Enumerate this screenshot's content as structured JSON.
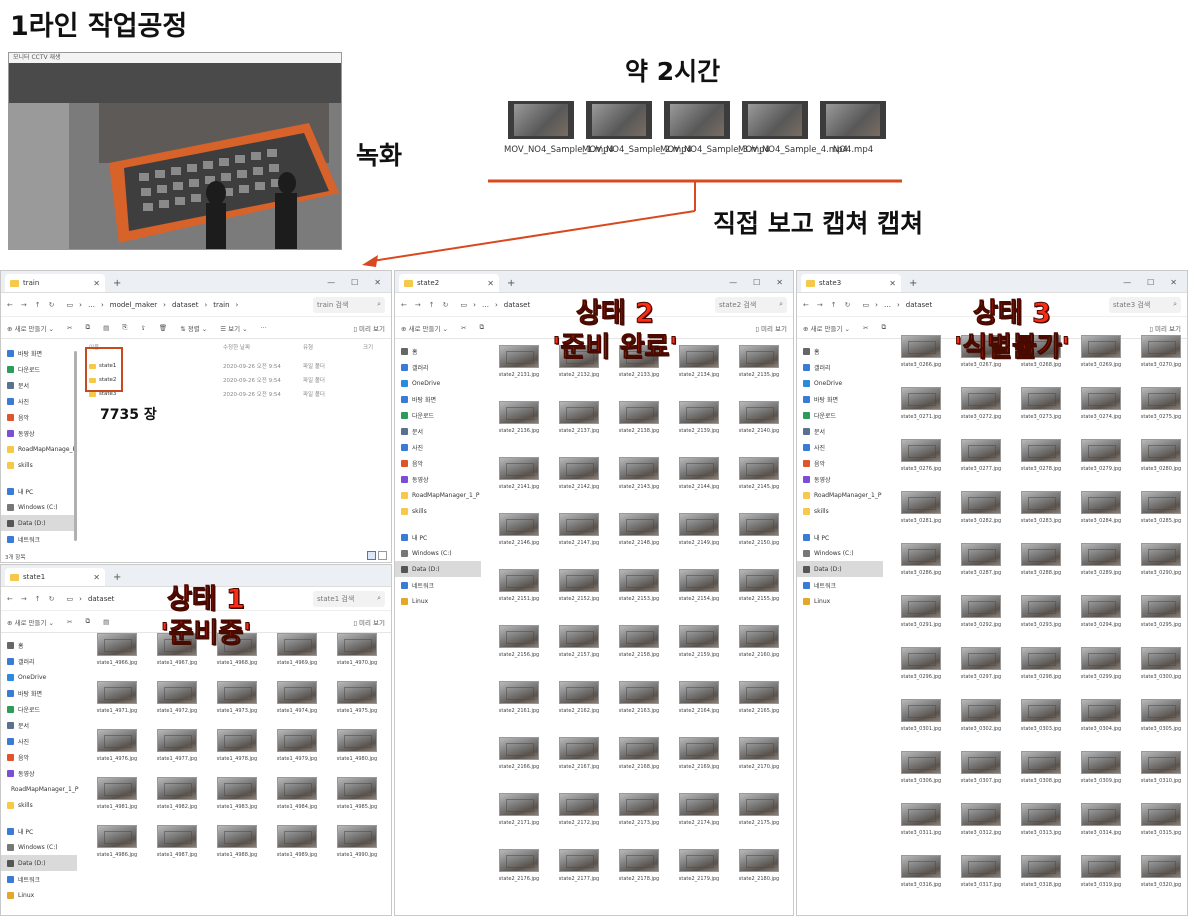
{
  "title": "1라인 작업공정",
  "video_window_title": "모니터 CCTV 재생",
  "record_label": "녹화",
  "duration_label": "약 2시간",
  "capture_label": "직접 보고 캡쳐 캡쳐",
  "accent_color": "#d9491f",
  "video_files": [
    {
      "name": "MOV_NO4_Sample_1.mp4"
    },
    {
      "name": "MOV_NO4_Sample_2.mp4"
    },
    {
      "name": "MOV_NO4_Sample_3.mp4"
    },
    {
      "name": "MOV_NO4_Sample_4.mp4"
    },
    {
      "name": "NO4.mp4"
    }
  ],
  "train_window": {
    "tab": "train",
    "breadcrumb": [
      "model_maker",
      "dataset",
      "train"
    ],
    "search": "train 검색",
    "new_label": "새로 만들기",
    "sort_label": "정렬",
    "view_label": "보기",
    "preview_label": "미리 보기",
    "columns": [
      "이름",
      "수정한 날짜",
      "유형",
      "크기"
    ],
    "rows": [
      {
        "name": "state1",
        "date": "2020-09-26 오전 9:54",
        "type": "파일 폴더"
      },
      {
        "name": "state2",
        "date": "2020-09-26 오전 9:54",
        "type": "파일 폴더"
      },
      {
        "name": "state3",
        "date": "2020-09-26 오전 9:54",
        "type": "파일 폴더"
      }
    ],
    "nav": [
      "바탕 화면",
      "다운로드",
      "문서",
      "사진",
      "음악",
      "동영상",
      "RoadMapManage_P",
      "skills",
      "내 PC",
      "Windows (C:)",
      "Data (D:)",
      "네트워크"
    ],
    "count": "7735 장",
    "status": "3개 항목"
  },
  "state1_window": {
    "tab": "state1",
    "crumb": "dataset",
    "search": "state1 검색",
    "new_label": "새로 만들기",
    "preview_label": "미리 보기",
    "overlay_line1": "상태 1",
    "overlay_line2": "'준비중'",
    "nav": [
      "홈",
      "갤러리",
      "OneDrive",
      "바탕 화면",
      "다운로드",
      "문서",
      "사진",
      "음악",
      "동영상",
      "RoadMapManager_1_P",
      "skills",
      "내 PC",
      "Windows (C:)",
      "Data (D:)",
      "네트워크",
      "Linux"
    ],
    "files": [
      "state1_4966.jpg",
      "state1_4967.jpg",
      "state1_4968.jpg",
      "state1_4969.jpg",
      "state1_4970.jpg",
      "state1_4971.jpg",
      "state1_4972.jpg",
      "state1_4973.jpg",
      "state1_4974.jpg",
      "state1_4975.jpg",
      "state1_4976.jpg",
      "state1_4977.jpg",
      "state1_4978.jpg",
      "state1_4979.jpg",
      "state1_4980.jpg",
      "state1_4981.jpg",
      "state1_4982.jpg",
      "state1_4983.jpg",
      "state1_4984.jpg",
      "state1_4985.jpg",
      "state1_4986.jpg",
      "state1_4987.jpg",
      "state1_4988.jpg",
      "state1_4989.jpg",
      "state1_4990.jpg"
    ]
  },
  "state2_window": {
    "tab": "state2",
    "crumb": "dataset",
    "search": "state2 검색",
    "new_label": "새로 만들기",
    "preview_label": "미리 보기",
    "overlay_line1": "상태 2",
    "overlay_line2": "'준비 완료'",
    "nav": [
      "홈",
      "갤러리",
      "OneDrive",
      "바탕 화면",
      "다운로드",
      "문서",
      "사진",
      "음악",
      "동영상",
      "RoadMapManager_1_P",
      "skills",
      "내 PC",
      "Windows (C:)",
      "Data (D:)",
      "네트워크",
      "Linux"
    ],
    "files": [
      "state2_2131.jpg",
      "state2_2132.jpg",
      "state2_2133.jpg",
      "state2_2134.jpg",
      "state2_2135.jpg",
      "state2_2136.jpg",
      "state2_2137.jpg",
      "state2_2138.jpg",
      "state2_2139.jpg",
      "state2_2140.jpg",
      "state2_2141.jpg",
      "state2_2142.jpg",
      "state2_2143.jpg",
      "state2_2144.jpg",
      "state2_2145.jpg",
      "state2_2146.jpg",
      "state2_2147.jpg",
      "state2_2148.jpg",
      "state2_2149.jpg",
      "state2_2150.jpg",
      "state2_2151.jpg",
      "state2_2152.jpg",
      "state2_2153.jpg",
      "state2_2154.jpg",
      "state2_2155.jpg",
      "state2_2156.jpg",
      "state2_2157.jpg",
      "state2_2158.jpg",
      "state2_2159.jpg",
      "state2_2160.jpg",
      "state2_2161.jpg",
      "state2_2162.jpg",
      "state2_2163.jpg",
      "state2_2164.jpg",
      "state2_2165.jpg",
      "state2_2166.jpg",
      "state2_2167.jpg",
      "state2_2168.jpg",
      "state2_2169.jpg",
      "state2_2170.jpg",
      "state2_2171.jpg",
      "state2_2172.jpg",
      "state2_2173.jpg",
      "state2_2174.jpg",
      "state2_2175.jpg",
      "state2_2176.jpg",
      "state2_2177.jpg",
      "state2_2178.jpg",
      "state2_2179.jpg",
      "state2_2180.jpg"
    ]
  },
  "state3_window": {
    "tab": "state3",
    "crumb": "dataset",
    "search": "state3 검색",
    "new_label": "새로 만들기",
    "preview_label": "미리 보기",
    "overlay_line1": "상태 3",
    "overlay_line2": "'식별불가'",
    "nav": [
      "홈",
      "갤러리",
      "OneDrive",
      "바탕 화면",
      "다운로드",
      "문서",
      "사진",
      "음악",
      "동영상",
      "RoadMapManager_1_P",
      "skills",
      "내 PC",
      "Windows (C:)",
      "Data (D:)",
      "네트워크",
      "Linux"
    ],
    "files": [
      "state3_0266.jpg",
      "state3_0267.jpg",
      "state3_0268.jpg",
      "state3_0269.jpg",
      "state3_0270.jpg",
      "state3_0271.jpg",
      "state3_0272.jpg",
      "state3_0273.jpg",
      "state3_0274.jpg",
      "state3_0275.jpg",
      "state3_0276.jpg",
      "state3_0277.jpg",
      "state3_0278.jpg",
      "state3_0279.jpg",
      "state3_0280.jpg",
      "state3_0281.jpg",
      "state3_0282.jpg",
      "state3_0283.jpg",
      "state3_0284.jpg",
      "state3_0285.jpg",
      "state3_0286.jpg",
      "state3_0287.jpg",
      "state3_0288.jpg",
      "state3_0289.jpg",
      "state3_0290.jpg",
      "state3_0291.jpg",
      "state3_0292.jpg",
      "state3_0293.jpg",
      "state3_0294.jpg",
      "state3_0295.jpg",
      "state3_0296.jpg",
      "state3_0297.jpg",
      "state3_0298.jpg",
      "state3_0299.jpg",
      "state3_0300.jpg",
      "state3_0301.jpg",
      "state3_0302.jpg",
      "state3_0303.jpg",
      "state3_0304.jpg",
      "state3_0305.jpg",
      "state3_0306.jpg",
      "state3_0307.jpg",
      "state3_0308.jpg",
      "state3_0309.jpg",
      "state3_0310.jpg",
      "state3_0311.jpg",
      "state3_0312.jpg",
      "state3_0313.jpg",
      "state3_0314.jpg",
      "state3_0315.jpg",
      "state3_0316.jpg",
      "state3_0317.jpg",
      "state3_0318.jpg",
      "state3_0319.jpg",
      "state3_0320.jpg"
    ]
  }
}
